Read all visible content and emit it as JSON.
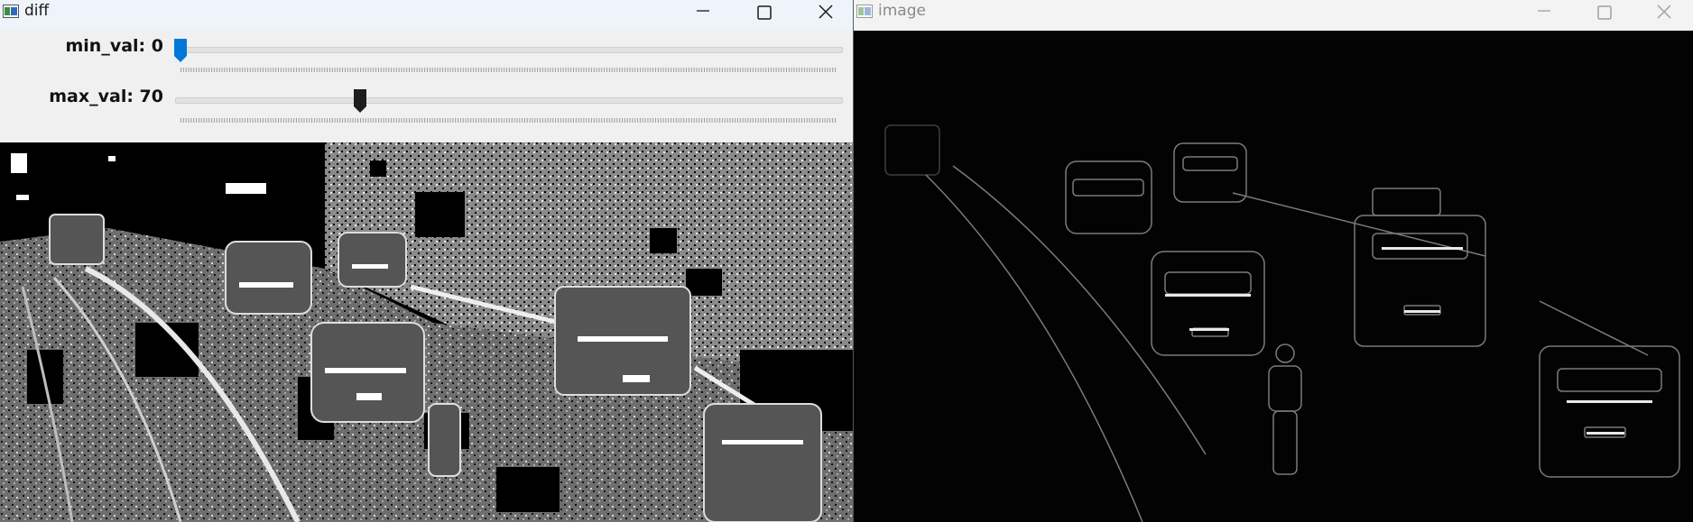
{
  "windows": {
    "diff": {
      "title": "diff",
      "trackbars": [
        {
          "label": "min_val: 0",
          "value": 0,
          "max": 255,
          "thumb_color": "#0078d7"
        },
        {
          "label": "max_val: 70",
          "value": 70,
          "max": 255,
          "thumb_color": "#1e1e1e"
        }
      ]
    },
    "image": {
      "title": "image"
    }
  },
  "icons": [
    "app-icon",
    "minimize-icon",
    "maximize-icon",
    "close-icon"
  ],
  "colors": {
    "accent": "#0078d7",
    "active_titlebar": "#eef4f9",
    "inactive_titlebar": "#f3f3f3"
  }
}
